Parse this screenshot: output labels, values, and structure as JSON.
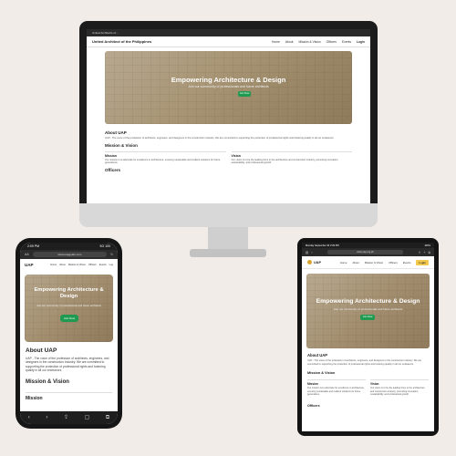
{
  "common": {
    "hero_title": "Empowering Architecture & Design",
    "hero_subtitle": "Join our community of professionals and future architects",
    "hero_button": "Join Now",
    "about_title": "About UAP",
    "about_text": "UAP - The voice of the profession of architects, engineers, and designers in the construction industry. We are committed to supporting the protection of professional rights and fostering quality in all our endeavors.",
    "mv_title": "Mission & Vision",
    "mission_title": "Mission",
    "mission_text": "Our mission is to advocate for excellence in architecture, ensuring sustainable and resilient solutions for future generations.",
    "vision_title": "Vision",
    "vision_text": "Our vision is to be the leading force in the architecture and construction industry, promoting innovation, sustainability, and professional growth.",
    "officers_title": "Officers",
    "colors": {
      "accent_green": "#1f9a50",
      "login_yellow": "#f2c94c",
      "background": "#f1ece8"
    }
  },
  "desktop": {
    "tab_title": "United Architects of...",
    "brand": "United Architect of the Philippines",
    "nav": [
      "Home",
      "About",
      "Mission & Vision",
      "Officers",
      "Events",
      "Login"
    ]
  },
  "phone": {
    "time": "2:09 PM",
    "status_right": "5G 100",
    "aa": "AA",
    "url": "www.uapguide.com",
    "brand": "UAP",
    "nav": [
      "Home",
      "About",
      "Mission & Vision",
      "Officers",
      "Events",
      "Log"
    ]
  },
  "tablet": {
    "status_left": "Monday September 30 2:09 PM",
    "status_right": "100%",
    "url": "www.uap.org.ph",
    "brand": "UAP",
    "nav": [
      "Home",
      "About",
      "Mission & Vision",
      "Officers",
      "Events",
      "Login"
    ]
  }
}
